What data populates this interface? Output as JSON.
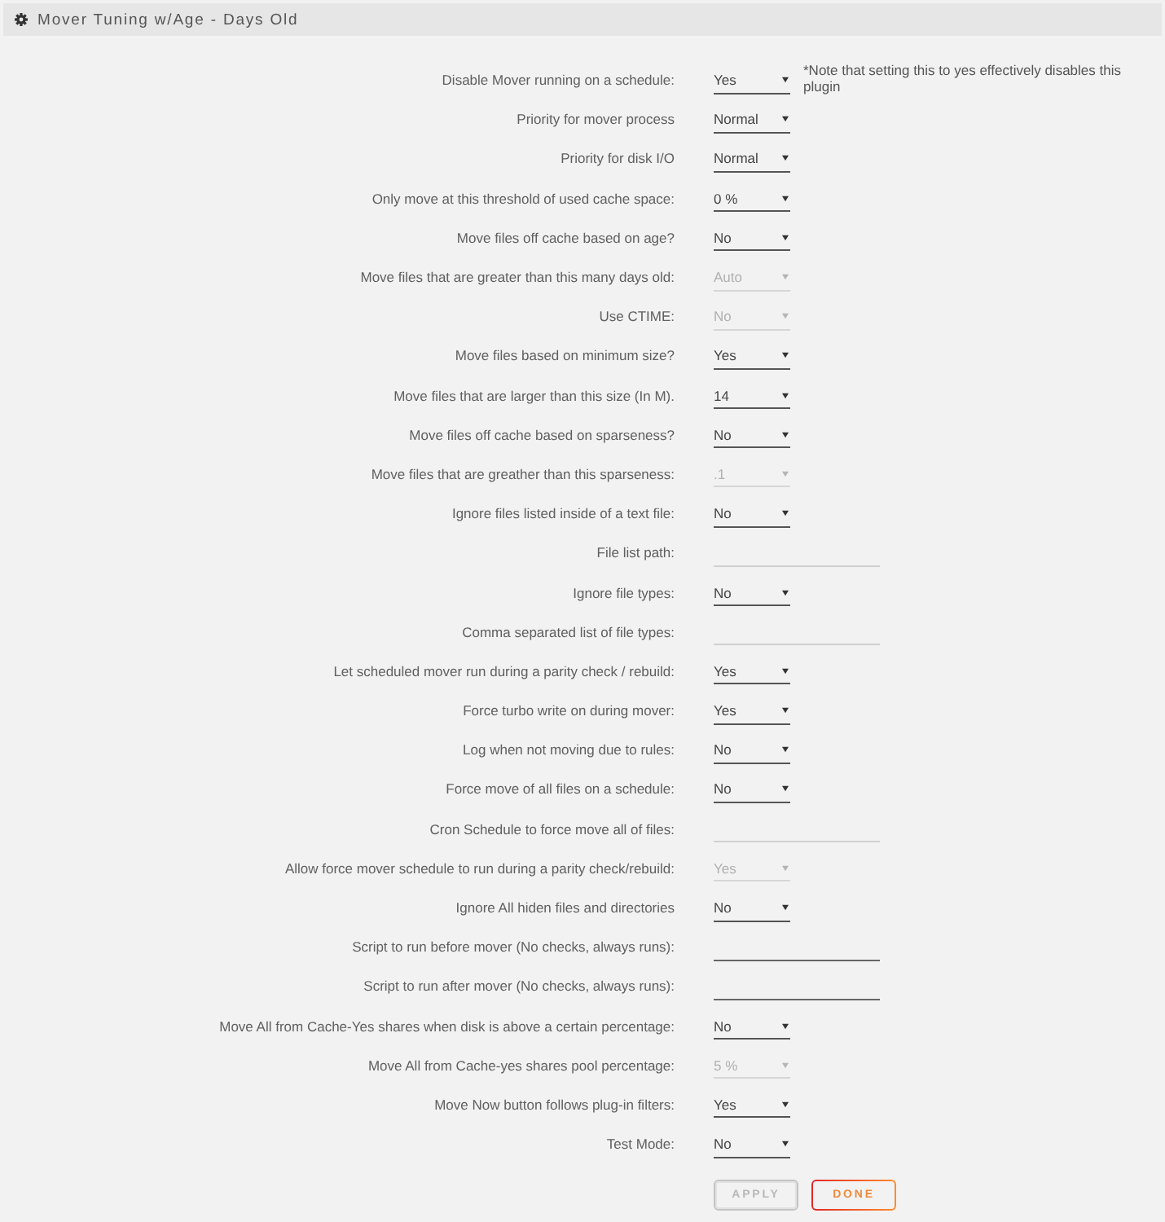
{
  "panel": {
    "title": "Mover Tuning w/Age - Days Old"
  },
  "settings": [
    {
      "label": "Disable Mover running on a schedule:",
      "kind": "select",
      "value": "Yes",
      "disabled": false,
      "note": "*Note that setting this to yes effectively disables this plugin"
    },
    {
      "label": "Priority for mover process",
      "kind": "select",
      "value": "Normal",
      "disabled": false
    },
    {
      "label": "Priority for disk I/O",
      "kind": "select",
      "value": "Normal",
      "disabled": false
    },
    {
      "label": "Only move at this threshold of used cache space:",
      "kind": "select",
      "value": "0 %",
      "disabled": false
    },
    {
      "label": "Move files off cache based on age?",
      "kind": "select",
      "value": "No",
      "disabled": false
    },
    {
      "label": "Move files that are greater than this many days old:",
      "kind": "select",
      "value": "Auto",
      "disabled": true
    },
    {
      "label": "Use CTIME:",
      "kind": "select",
      "value": "No",
      "disabled": true
    },
    {
      "label": "Move files based on minimum size?",
      "kind": "select",
      "value": "Yes",
      "disabled": false
    },
    {
      "label": "Move files that are larger than this size (In M).",
      "kind": "select",
      "value": "14",
      "disabled": false
    },
    {
      "label": "Move files off cache based on sparseness?",
      "kind": "select",
      "value": "No",
      "disabled": false
    },
    {
      "label": "Move files that are greather than this sparseness:",
      "kind": "select",
      "value": ".1",
      "disabled": true
    },
    {
      "label": "Ignore files listed inside of a text file:",
      "kind": "select",
      "value": "No",
      "disabled": false
    },
    {
      "label": "File list path:",
      "kind": "text",
      "disabled": true
    },
    {
      "label": "Ignore file types:",
      "kind": "select",
      "value": "No",
      "disabled": false
    },
    {
      "label": "Comma separated list of file types:",
      "kind": "text",
      "disabled": true
    },
    {
      "label": "Let scheduled mover run during a parity check / rebuild:",
      "kind": "select",
      "value": "Yes",
      "disabled": false
    },
    {
      "label": "Force turbo write on during mover:",
      "kind": "select",
      "value": "Yes",
      "disabled": false
    },
    {
      "label": "Log when not moving due to rules:",
      "kind": "select",
      "value": "No",
      "disabled": false
    },
    {
      "label": "Force move of all files on a schedule:",
      "kind": "select",
      "value": "No",
      "disabled": false
    },
    {
      "label": "Cron Schedule to force move all of files:",
      "kind": "text",
      "disabled": true
    },
    {
      "label": "Allow force mover schedule to run during a parity check/rebuild:",
      "kind": "select",
      "value": "Yes",
      "disabled": true
    },
    {
      "label": "Ignore All hiden files and directories",
      "kind": "select",
      "value": "No",
      "disabled": false
    },
    {
      "label": "Script to run before mover (No checks, always runs):",
      "kind": "text",
      "disabled": false
    },
    {
      "label": "Script to run after mover (No checks, always runs):",
      "kind": "text",
      "disabled": false
    },
    {
      "label": "Move All from Cache-Yes shares when disk is above a certain percentage:",
      "kind": "select",
      "value": "No",
      "disabled": false
    },
    {
      "label": "Move All from Cache-yes shares pool percentage:",
      "kind": "select",
      "value": "5 %",
      "disabled": true
    },
    {
      "label": "Move Now button follows plug-in filters:",
      "kind": "select",
      "value": "Yes",
      "disabled": false
    },
    {
      "label": "Test Mode:",
      "kind": "select",
      "value": "No",
      "disabled": false
    }
  ],
  "buttons": [
    {
      "label": "APPLY",
      "disabled": true
    },
    {
      "label": "DONE",
      "disabled": false
    }
  ]
}
